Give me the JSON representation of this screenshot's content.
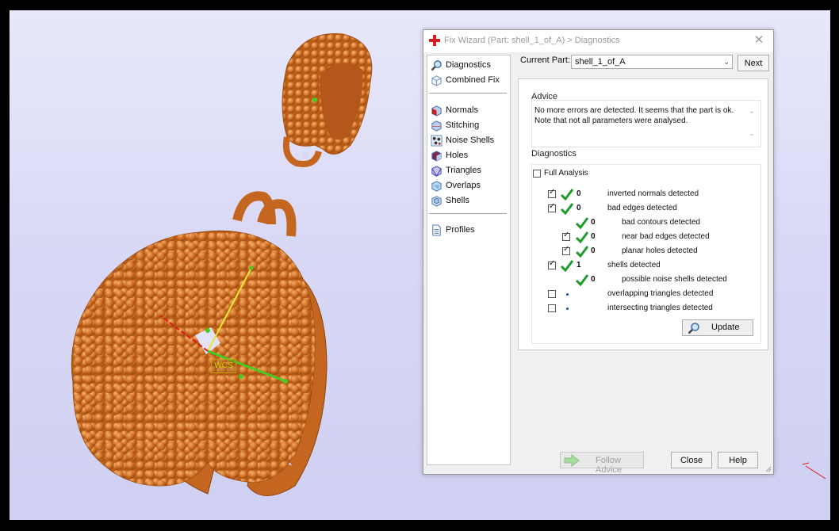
{
  "dialog": {
    "title": "Fix Wizard (Part: shell_1_of_A) > Diagnostics",
    "close_glyph": "✕"
  },
  "nav": {
    "items": [
      {
        "label": "Diagnostics",
        "icon": "magnifier-icon"
      },
      {
        "label": "Combined Fix",
        "icon": "cube-outline-icon"
      },
      {
        "label": "Normals",
        "icon": "cube-red-face-icon"
      },
      {
        "label": "Stitching",
        "icon": "cube-stitch-icon"
      },
      {
        "label": "Noise Shells",
        "icon": "noise-dots-icon"
      },
      {
        "label": "Holes",
        "icon": "cube-hole-icon"
      },
      {
        "label": "Triangles",
        "icon": "cube-triangles-icon"
      },
      {
        "label": "Overlaps",
        "icon": "cube-overlap-icon"
      },
      {
        "label": "Shells",
        "icon": "cube-shells-icon"
      },
      {
        "label": "Profiles",
        "icon": "document-icon"
      }
    ]
  },
  "current_part": {
    "label": "Current Part:",
    "value": "shell_1_of_A",
    "next_label": "Next"
  },
  "advice": {
    "group_label": "Advice",
    "text": "No more errors are detected. It seems that the part is ok. Note that not all parameters were analysed."
  },
  "diagnostics": {
    "group_label": "Diagnostics",
    "full_analysis_label": "Full Analysis",
    "full_analysis_checked": false,
    "rows": [
      {
        "label": "inverted normals detected",
        "count": "0",
        "checked": true,
        "status": "ok"
      },
      {
        "label": "bad edges detected",
        "count": "0",
        "checked": true,
        "status": "ok"
      },
      {
        "label": "bad contours detected",
        "count": "0",
        "checked": null,
        "status": "ok"
      },
      {
        "label": "near bad edges detected",
        "count": "0",
        "checked": true,
        "status": "ok"
      },
      {
        "label": "planar holes detected",
        "count": "0",
        "checked": true,
        "status": "ok"
      },
      {
        "label": "shells detected",
        "count": "1",
        "checked": true,
        "status": "ok"
      },
      {
        "label": "possible noise shells detected",
        "count": "0",
        "checked": null,
        "status": "ok"
      },
      {
        "label": "overlapping triangles detected",
        "count": "",
        "checked": false,
        "status": "not-run"
      },
      {
        "label": "intersecting triangles detected",
        "count": "",
        "checked": false,
        "status": "not-run"
      }
    ],
    "update_label": "Update"
  },
  "footer": {
    "follow_advice_label": "Follow Advice",
    "close_label": "Close",
    "help_label": "Help"
  },
  "viewport": {
    "wcs_label": "WCS",
    "colors": {
      "part": "#d9772a",
      "background": "#dcdcf6",
      "x_axis": "#e01818",
      "y_axis": "#e8e830",
      "z_axis": "#44cc22"
    }
  }
}
